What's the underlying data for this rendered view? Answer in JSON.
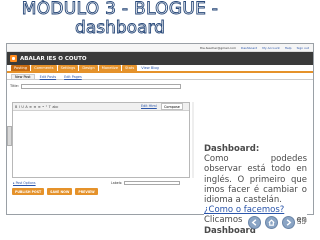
{
  "slide": {
    "title_line1": "MÓDULO 3 -   BLOGUE -",
    "title_line2": "dashboard",
    "page_number": "33"
  },
  "screenshot": {
    "topbar": {
      "email": "the.teacher@gmail.com",
      "links": [
        "Dashboard",
        "My Account",
        "Help",
        "Sign out"
      ]
    },
    "header": {
      "blog_name": "ABALAR IES O COUTO"
    },
    "tabs": [
      {
        "label": "Posting"
      },
      {
        "label": "Comments"
      },
      {
        "label": "Settings"
      },
      {
        "label": "Design"
      },
      {
        "label": "Monetize"
      },
      {
        "label": "Stats"
      },
      {
        "label": "View Blog"
      }
    ],
    "subtabs": [
      {
        "label": "New Post"
      },
      {
        "label": "Edit Posts"
      },
      {
        "label": "Edit Pages"
      }
    ],
    "editor": {
      "title_label": "Title:",
      "title_value": "",
      "toolbar_items": [
        "B",
        "I",
        "U",
        "A",
        "≡",
        "≡",
        "≡",
        "•",
        "\"",
        "T",
        "abc"
      ],
      "mode_html": "Edit Html",
      "mode_compose": "Compose"
    },
    "post_options_link": "▸ Post Options",
    "labels_label": "Labels:",
    "labels_value": "",
    "buttons": {
      "publish": "PUBLISH POST",
      "save": "SAVE NOW",
      "preview": "PREVIEW"
    }
  },
  "callout": {
    "heading": "Dashboard:",
    "body": "Como podedes observar está todo en inglés. O primeiro que imos facer é cambiar o idioma a castelán.",
    "question": "¿Como o facemos?",
    "action_prefix": "Clicamos en ",
    "action_target": "Dashboard"
  }
}
